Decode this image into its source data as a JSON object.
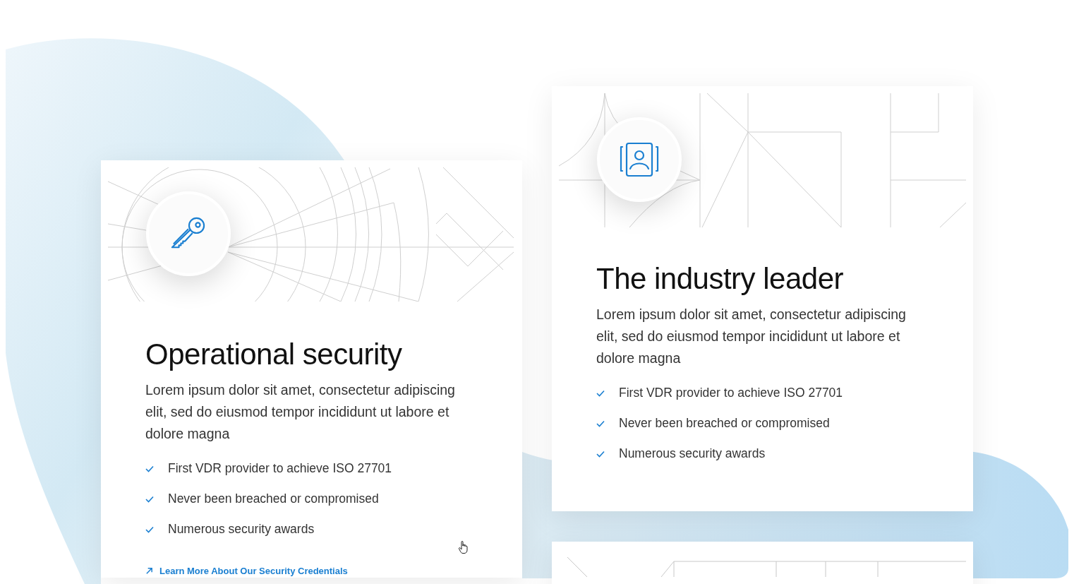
{
  "cards": [
    {
      "title": "Operational security",
      "body": "Lorem ipsum dolor sit amet, consectetur adipiscing elit, sed do eiusmod tempor incididunt ut labore et dolore magna",
      "features": [
        "First VDR provider to achieve ISO 27701",
        "Never been breached or compromised",
        "Numerous security awards"
      ],
      "link": "Learn More About Our Security Credentials"
    },
    {
      "title": "The industry leader",
      "body": "Lorem ipsum dolor sit amet, consectetur adipiscing elit, sed do eiusmod tempor incididunt ut labore et dolore magna",
      "features": [
        "First VDR provider to achieve ISO 27701",
        "Never been breached or compromised",
        "Numerous security awards"
      ]
    }
  ]
}
